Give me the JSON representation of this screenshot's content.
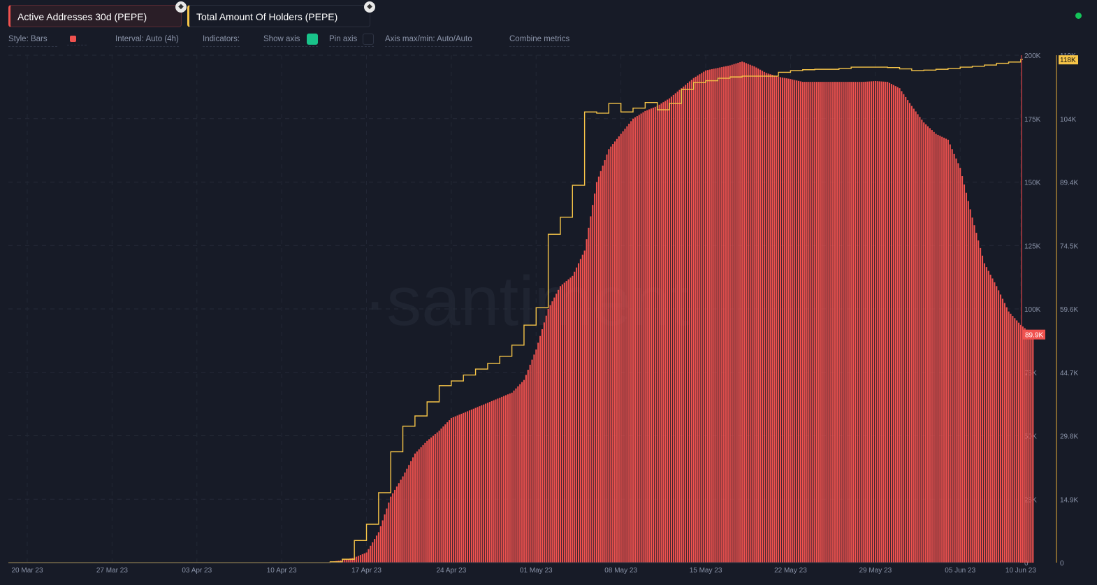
{
  "metrics": [
    {
      "label": "Active Addresses 30d (PEPE)",
      "color": "#f0524f"
    },
    {
      "label": "Total Amount Of Holders (PEPE)",
      "color": "#f7c548"
    }
  ],
  "options": {
    "style": "Style: Bars",
    "interval": "Interval: Auto (4h)",
    "indicators": "Indicators:",
    "show_axis": "Show axis",
    "pin_axis": "Pin axis",
    "axis_minmax": "Axis max/min: Auto/Auto",
    "combine": "Combine metrics"
  },
  "watermark": "·santiment",
  "chart_data": {
    "type": "bar",
    "x_ticks": [
      "20 Mar 23",
      "27 Mar 23",
      "03 Apr 23",
      "10 Apr 23",
      "17 Apr 23",
      "24 Apr 23",
      "01 May 23",
      "08 May 23",
      "15 May 23",
      "22 May 23",
      "29 May 23",
      "05 Jun 23",
      "10 Jun 23"
    ],
    "x_start": "2023-03-20",
    "y_left": {
      "ticks": [
        "0",
        "25K",
        "50K",
        "75K",
        "100K",
        "125K",
        "150K",
        "175K",
        "200K"
      ],
      "range": [
        0,
        200
      ],
      "last_label": "89.9K",
      "color": "#f0524f"
    },
    "y_right": {
      "ticks": [
        "0",
        "14.9K",
        "29.8K",
        "44.7K",
        "59.6K",
        "74.5K",
        "89.4K",
        "104K",
        "119K"
      ],
      "range": [
        0,
        119
      ],
      "last_label": "118K",
      "color": "#f7c548"
    },
    "series": [
      {
        "name": "Active Addresses 30d (PEPE)",
        "type": "bar",
        "unit": "K",
        "start_day": 25,
        "values": [
          0.3,
          1,
          2,
          4,
          12,
          26,
          34,
          43,
          48,
          52,
          57,
          59,
          61,
          63,
          65,
          67,
          72,
          84,
          100,
          109,
          113,
          123,
          150,
          163,
          169,
          175,
          178,
          180,
          183,
          187,
          191,
          194,
          195,
          196,
          197.5,
          195.6,
          193,
          191.5,
          190.6,
          189.5,
          189.5,
          189.5,
          189.5,
          189.5,
          189.5,
          189.8,
          189.5,
          187,
          180,
          173.5,
          169,
          166.7,
          155.6,
          136,
          118,
          109,
          99,
          93.7,
          89.9
        ]
      },
      {
        "name": "Total Amount Of Holders (PEPE)",
        "type": "line",
        "unit": "K",
        "start_day": 0,
        "values": [
          0,
          0,
          0,
          0,
          0,
          0,
          0,
          0,
          0,
          0,
          0,
          0,
          0,
          0,
          0,
          0,
          0,
          0,
          0,
          0,
          0,
          0,
          0,
          0,
          0,
          0.2,
          0.8,
          5.2,
          9,
          16.4,
          26,
          32,
          34.4,
          37.7,
          41.5,
          42.6,
          44,
          45.4,
          46.7,
          48.4,
          51,
          55.7,
          59.8,
          77,
          81,
          88.5,
          105.7,
          105.4,
          107.7,
          105.7,
          106.6,
          107.9,
          106.2,
          107.7,
          111,
          112.6,
          113,
          113.6,
          113.9,
          114.1,
          114.1,
          114.1,
          115,
          115.4,
          115.6,
          115.7,
          115.7,
          115.9,
          116.2,
          116.2,
          116.2,
          116.1,
          115.8,
          115.4,
          115.5,
          115.7,
          115.9,
          116.2,
          116.4,
          116.7,
          117.1,
          117.4,
          118
        ]
      }
    ]
  }
}
